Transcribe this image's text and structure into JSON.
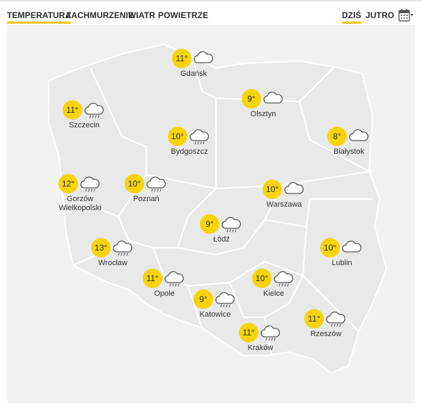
{
  "tabs": [
    {
      "label": "TEMPERATURA",
      "active": true
    },
    {
      "label": "ZACHMURZENIE",
      "active": false
    },
    {
      "label": "WIATR",
      "active": false
    },
    {
      "label": "POWIETRZE",
      "active": false
    }
  ],
  "day_tabs": [
    {
      "label": "DZIŚ",
      "active": true
    },
    {
      "label": "JUTRO",
      "active": false
    }
  ],
  "calendar": {
    "icon": "calendar-icon",
    "dropdown_icon": "chevron-down-icon"
  },
  "colors": {
    "accent": "#f5c400",
    "temp_badge": "#f7d40a",
    "map_fill": "#e9e9e9",
    "border": "#ffffff"
  },
  "cities": [
    {
      "name": "Gdańsk",
      "temp": "11°",
      "icon": "cloud-icon"
    },
    {
      "name": "Olsztyn",
      "temp": "9°",
      "icon": "cloud-icon"
    },
    {
      "name": "Szczecin",
      "temp": "11°",
      "icon": "cloud-rain-icon"
    },
    {
      "name": "Bydgoszcz",
      "temp": "10°",
      "icon": "cloud-rain-icon"
    },
    {
      "name": "Białystok",
      "temp": "8°",
      "icon": "cloud-icon"
    },
    {
      "name": "Gorzów\nWielkopolski",
      "temp": "12°",
      "icon": "cloud-rain-icon"
    },
    {
      "name": "Poznań",
      "temp": "10°",
      "icon": "cloud-rain-icon"
    },
    {
      "name": "Warszawa",
      "temp": "10°",
      "icon": "cloud-icon"
    },
    {
      "name": "Łódź",
      "temp": "9°",
      "icon": "cloud-rain-icon"
    },
    {
      "name": "Wrocław",
      "temp": "13°",
      "icon": "cloud-rain-icon"
    },
    {
      "name": "Lublin",
      "temp": "10°",
      "icon": "cloud-icon"
    },
    {
      "name": "Opole",
      "temp": "11°",
      "icon": "cloud-rain-icon"
    },
    {
      "name": "Kielce",
      "temp": "10°",
      "icon": "cloud-rain-icon"
    },
    {
      "name": "Katowice",
      "temp": "9°",
      "icon": "cloud-rain-icon"
    },
    {
      "name": "Rzeszów",
      "temp": "11°",
      "icon": "cloud-rain-icon"
    },
    {
      "name": "Kraków",
      "temp": "11°",
      "icon": "cloud-rain-icon"
    }
  ]
}
